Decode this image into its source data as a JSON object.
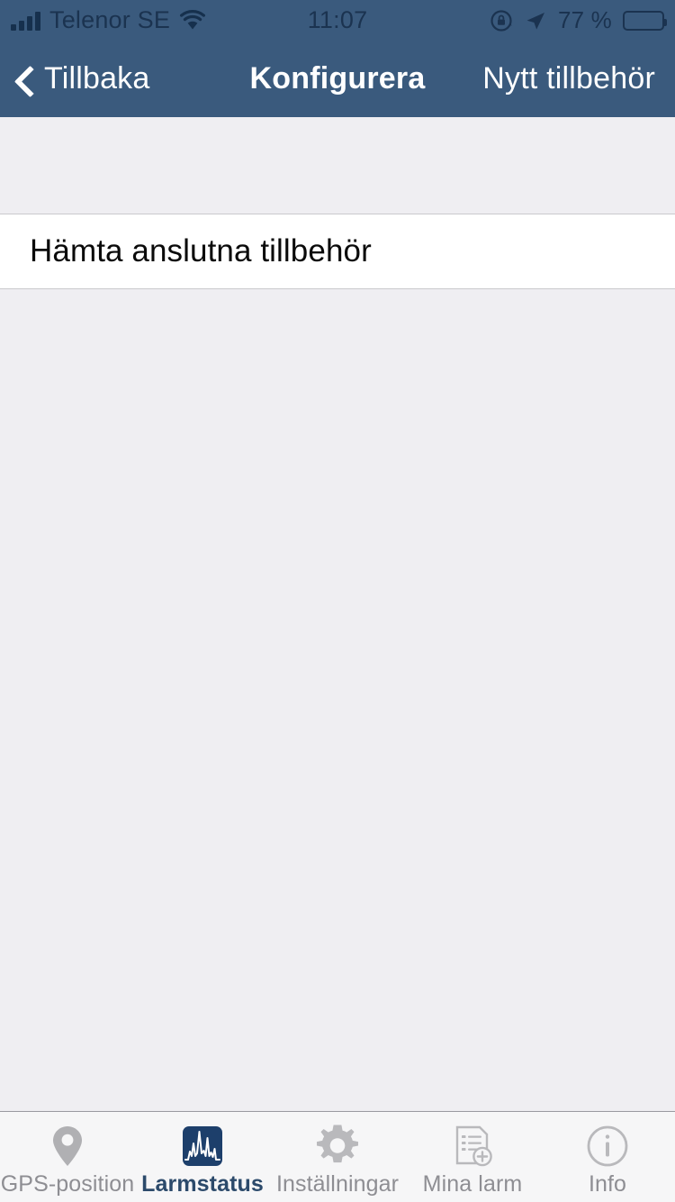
{
  "status_bar": {
    "carrier": "Telenor SE",
    "signal_icon": "signal-bars-icon",
    "wifi_icon": "wifi-icon",
    "time": "11:07",
    "rotation_lock_icon": "rotation-lock-icon",
    "location_icon": "location-arrow-icon",
    "battery_percent": "77 %",
    "battery_icon": "battery-icon",
    "battery_level": 77
  },
  "nav_bar": {
    "back_label": "Tillbaka",
    "back_icon": "chevron-left-icon",
    "title": "Konfigurera",
    "right_action": "Nytt tillbehör",
    "background_color": "#3a5a7d",
    "text_color": "#ffffff"
  },
  "content": {
    "rows": [
      {
        "label": "Hämta anslutna tillbehör"
      }
    ],
    "background_color": "#efeef2"
  },
  "tab_bar": {
    "active_index": 1,
    "active_color": "#2c4a6b",
    "inactive_color": "#8e8e93",
    "items": [
      {
        "label": "GPS-position",
        "icon": "map-pin-icon"
      },
      {
        "label": "Larmstatus",
        "icon": "waveform-spectrum-icon"
      },
      {
        "label": "Inställningar",
        "icon": "gear-icon"
      },
      {
        "label": "Mina larm",
        "icon": "document-add-icon"
      },
      {
        "label": "Info",
        "icon": "info-circle-icon"
      }
    ]
  }
}
